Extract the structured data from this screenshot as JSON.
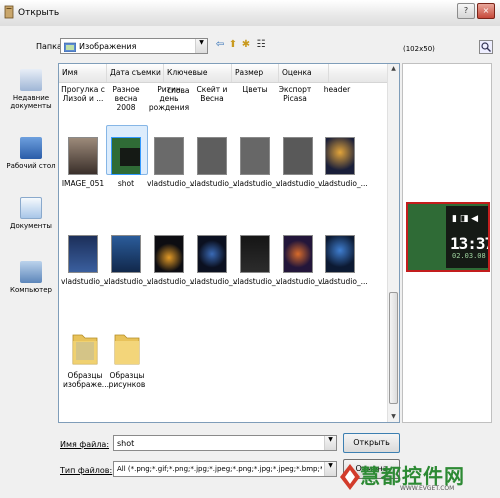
{
  "window": {
    "title": "Открыть",
    "help_button": "?",
    "close_button": "×"
  },
  "toolbar": {
    "folder_label": "Папка:",
    "folder_value": "Изображения",
    "back_glyph": "⇦",
    "up_glyph": "⬆",
    "newfolder_glyph": "✱",
    "views_glyph": "☷"
  },
  "preview_size_label": "(102x50)",
  "places": [
    {
      "label": "Недавние документы",
      "icon": "recent-docs-icon",
      "color": "#6f8fb8"
    },
    {
      "label": "Рабочий стол",
      "icon": "desktop-icon",
      "color": "#3b6fb6"
    },
    {
      "label": "Документы",
      "icon": "documents-icon",
      "color": "#7aa7d6"
    },
    {
      "label": "Компьютер",
      "icon": "computer-icon",
      "color": "#4d7fb8"
    }
  ],
  "columns": [
    "Имя",
    "Дата съемки",
    "Ключевые слова",
    "Размер",
    "Оценка"
  ],
  "top_row_partial": [
    "Прогулка с Лизой и ...",
    "Разное весна 2008",
    "Ритин день рождения",
    "Скейт и Весна",
    "Цветы",
    "Экспорт Picasa",
    "header"
  ],
  "row2": [
    "IMAGE_051",
    "shot",
    "vladstudio_...",
    "vladstudio_...",
    "vladstudio_...",
    "vladstudio_...",
    "vladstudio_..."
  ],
  "row3": [
    "vladstudio_...",
    "vladstudio_...",
    "vladstudio_...",
    "vladstudio_...",
    "vladstudio_...",
    "vladstudio_...",
    "vladstudio_..."
  ],
  "row4": [
    "Образцы изображе...",
    "Образцы рисунков"
  ],
  "filename": {
    "label": "Имя файла:",
    "value": "shot"
  },
  "filetype": {
    "label": "Тип файлов:",
    "value": "All (*.png;*.gif;*.png;*.jpg;*.jpeg;*.png;*.jpg;*.jpeg;*.bmp;*.tif;*.tiff;*.ico;*.emf;*.wmf)"
  },
  "buttons": {
    "open": "Открыть",
    "cancel": "Отмена"
  },
  "preview_clock": {
    "time": "13:37",
    "date": "02.03.08"
  },
  "watermark": {
    "text": "慧都控件网",
    "url": "WWW.EVGET.COM"
  }
}
